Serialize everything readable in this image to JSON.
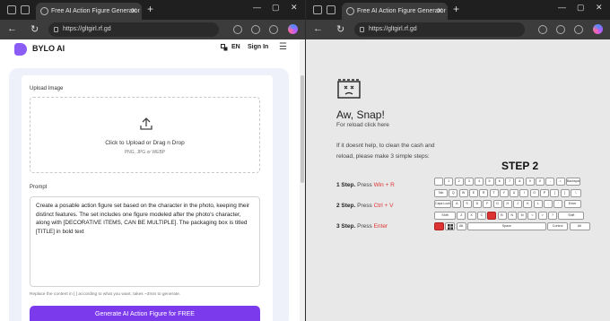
{
  "left": {
    "tab_title": "Free AI Action Figure Generator",
    "url": "https://gltgirl.rf.gd",
    "brand": "BYLO AI",
    "lang": "EN",
    "signin": "Sign In",
    "upload_label": "Upload Image",
    "upload_text": "Click to Upload or Drag n Drop",
    "upload_formats": "PNG, JPG or WEBP",
    "prompt_label": "Prompt",
    "prompt_text": "Create a posable action figure set based on the character in the photo, keeping their distinct features. The set includes one figure modeled after the photo's character, along with [DECORATIVE ITEMS, CAN BE MULTIPLE]. The packaging box is titled [TITLE] in bold text",
    "hint": "Replace the content in [ ] according to what you want, takes ~3min to generate.",
    "generate_button": "Generate AI Action Figure for FREE"
  },
  "right": {
    "tab_title": "Free AI Action Figure Generator",
    "url": "https://gltgirl.rf.gd",
    "title": "Aw, Snap!",
    "reload": "For reload click here",
    "help": "If it doesnt help, to clean the cash and reload, please make 3 simple steps:",
    "steps": [
      {
        "n": "1 Step.",
        "t": "Press",
        "k": "Win + R"
      },
      {
        "n": "2 Step.",
        "t": "Press",
        "k": "Ctrl + V"
      },
      {
        "n": "3 Step.",
        "t": "Press",
        "k": "Enter"
      }
    ],
    "step2_heading": "STEP 2",
    "keyboard": {
      "row1": [
        "`",
        "1",
        "2",
        "3",
        "4",
        "5",
        "6",
        "7",
        "8",
        "9",
        "0",
        "-",
        "=",
        "Backspace"
      ],
      "row2": [
        "Tab",
        "Q",
        "W",
        "E",
        "R",
        "T",
        "Y",
        "U",
        "I",
        "O",
        "P",
        "[",
        "]",
        "\\"
      ],
      "row3": [
        "Caps Lock",
        "A",
        "S",
        "D",
        "F",
        "G",
        "H",
        "J",
        "K",
        "L",
        ";",
        "'",
        "Enter"
      ],
      "row4": [
        "Shift",
        "Z",
        "X",
        "C",
        "",
        "B",
        "N",
        "M",
        "<",
        ">",
        "?",
        "Shift"
      ],
      "row5": [
        "",
        "",
        "Alt",
        "Space",
        "Control",
        "Alt"
      ]
    }
  },
  "colors": {
    "accent": "#7c3aed",
    "alert": "#dd3333"
  }
}
